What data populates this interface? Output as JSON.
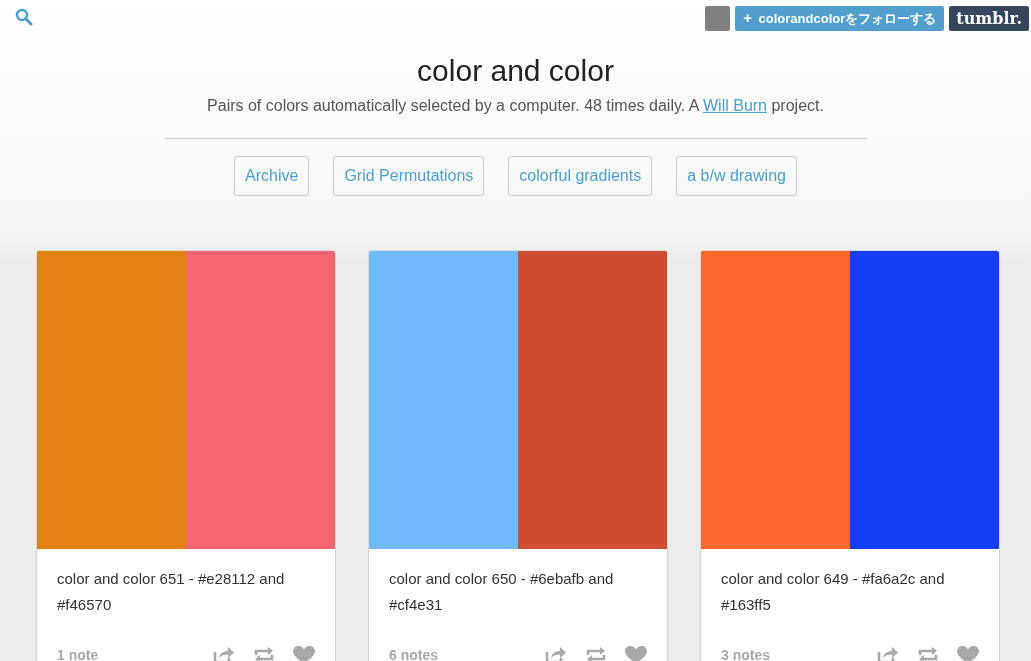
{
  "topbar": {
    "follow_button": "colorandcolorをフォローする",
    "follow_icon": "+",
    "logo": "tumblr."
  },
  "header": {
    "title": "color and color",
    "description_before": "Pairs of colors automatically selected by a computer. 48 times daily. A ",
    "description_link": "Will Burn",
    "description_after": " project."
  },
  "nav": [
    "Archive",
    "Grid Permutations",
    "colorful gradients",
    "a b/w drawing"
  ],
  "posts": [
    {
      "swatches": [
        {
          "color": "#e28112"
        },
        {
          "color": "#f46570"
        }
      ],
      "caption": "color and color 651 - #e28112 and #f46570",
      "notes": "1 note"
    },
    {
      "swatches": [
        {
          "color": "#6ebafb"
        },
        {
          "color": "#cf4e31"
        }
      ],
      "caption": "color and color 650 - #6ebafb and #cf4e31",
      "notes": "6 notes"
    },
    {
      "swatches": [
        {
          "color": "#fa6a2c"
        },
        {
          "color": "#163ff5"
        }
      ],
      "caption": "color and color 649 - #fa6a2c and #163ff5",
      "notes": "3 notes"
    }
  ]
}
